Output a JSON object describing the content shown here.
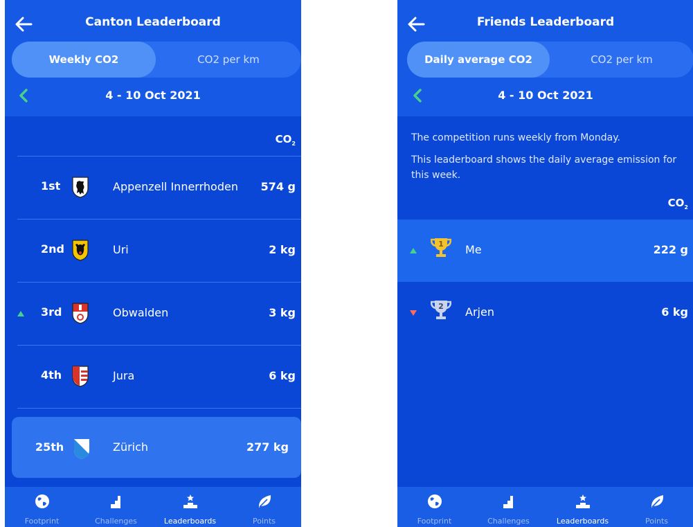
{
  "left": {
    "title": "Canton Leaderboard",
    "tabs": [
      "Weekly CO2",
      "CO2 per km"
    ],
    "week": "4 - 10 Oct 2021",
    "co2_header": "CO",
    "co2_sub": "2",
    "rows": [
      {
        "rank": "1st",
        "name": "Appenzell Innerrhoden",
        "value": "574 g",
        "trend": ""
      },
      {
        "rank": "2nd",
        "name": "Uri",
        "value": "2 kg",
        "trend": ""
      },
      {
        "rank": "3rd",
        "name": "Obwalden",
        "value": "3 kg",
        "trend": "up"
      },
      {
        "rank": "4th",
        "name": "Jura",
        "value": "6 kg",
        "trend": ""
      }
    ],
    "highlight": {
      "rank": "25th",
      "name": "Zürich",
      "value": "277 kg"
    }
  },
  "right": {
    "title": "Friends Leaderboard",
    "tabs": [
      "Daily average CO2",
      "CO2 per km"
    ],
    "week": "4 - 10 Oct 2021",
    "info1": "The competition runs weekly from Monday.",
    "info2": "This leaderboard shows the daily average emission for this week.",
    "co2_header": "CO",
    "co2_sub": "2",
    "friends": [
      {
        "place": "1",
        "name": "Me",
        "value": "222 g",
        "trend": "up"
      },
      {
        "place": "2",
        "name": "Arjen",
        "value": "6 kg",
        "trend": "down"
      }
    ]
  },
  "tabbar": {
    "footprint": "Footprint",
    "challenges": "Challenges",
    "leaderboards": "Leaderboards",
    "points": "Points"
  },
  "colors": {
    "background": "#0a47d6",
    "header": "#1559e4",
    "highlight": "#2f73ef",
    "trend_up": "#47d18a",
    "trend_down": "#ff6b5e",
    "gold": "#f2c230",
    "silver": "#c9d4ec"
  },
  "icons": {
    "back": "arrow-left-icon",
    "prev": "chevron-left-icon",
    "footprint": "globe-icon",
    "challenges": "stairs-icon",
    "leaderboards": "podium-icon",
    "points": "leaf-icon"
  }
}
